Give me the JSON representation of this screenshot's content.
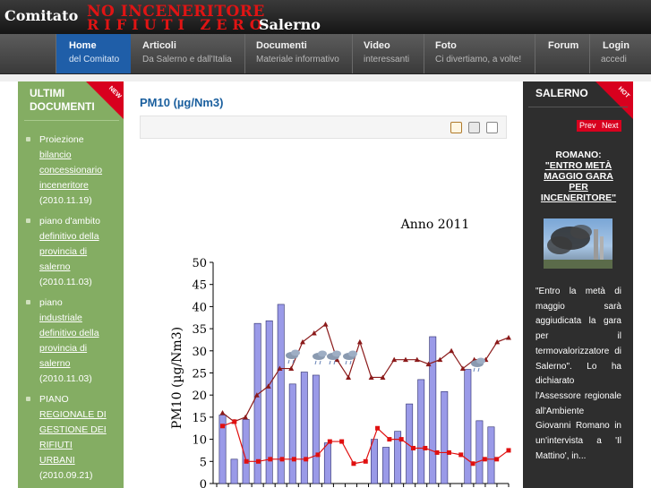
{
  "header": {
    "logo_left": "Comitato",
    "logo_red_line1": "NO INCENERITORE",
    "logo_red_line2": "RIFIUTI ZERO",
    "logo_right": "Salerno"
  },
  "nav": [
    {
      "title": "Home",
      "subtitle": "del Comitato",
      "active": true
    },
    {
      "title": "Articoli",
      "subtitle": "Da Salerno e dall'Italia"
    },
    {
      "title": "Documenti",
      "subtitle": "Materiale informativo"
    },
    {
      "title": "Video",
      "subtitle": "interessanti"
    },
    {
      "title": "Foto",
      "subtitle": "Ci divertiamo, a volte!"
    },
    {
      "title": "Forum",
      "subtitle": ""
    },
    {
      "title": "Login",
      "subtitle": "accedi"
    }
  ],
  "left_sidebar": {
    "title_line1": "ULTIMI",
    "title_line2": "DOCUMENTI",
    "badge": "NEW",
    "items": [
      {
        "prefix": "Proiezione",
        "link": [
          "bilancio",
          "concessionario",
          "inceneritore"
        ],
        "date": "(2010.11.19)"
      },
      {
        "prefix": "piano d'ambito",
        "link": [
          "definitivo della",
          "provincia di",
          "salerno"
        ],
        "date": "(2010.11.03)"
      },
      {
        "prefix": "piano",
        "link": [
          "industriale",
          "definitivo della",
          "provincia di",
          "salerno"
        ],
        "date": "(2010.11.03)"
      },
      {
        "prefix": "PIANO",
        "link": [
          "REGIONALE DI",
          "GESTIONE DEI",
          "RIFIUTI",
          "URBANI"
        ],
        "date": "(2010.09.21)"
      }
    ]
  },
  "main": {
    "title": "PM10 (µg/Nm3)",
    "tools": [
      "edit-icon",
      "print-icon",
      "email-icon"
    ]
  },
  "right_sidebar": {
    "title": "SALERNO",
    "badge": "HOT",
    "prev_label": "Prev",
    "next_label": "Next",
    "news_title_line1": "ROMANO:",
    "news_title_link": "\"ENTRO METÀ MAGGIO GARA PER INCENERITORE\"",
    "news_text": "\"Entro la metà di maggio sarà aggiudicata la gara per il termovalorizzatore di Salerno\". Lo ha dichiarato l'Assessore regionale all'Ambiente Giovanni Romano in un'intervista a 'Il Mattino', in..."
  },
  "chart_data": {
    "type": "bar",
    "title": "Anno 2011",
    "ylabel": "PM10 (µg/Nm3)",
    "ylim": [
      0,
      50
    ],
    "yticks": [
      0,
      5,
      10,
      15,
      20,
      25,
      30,
      35,
      40,
      45,
      50
    ],
    "grid": false,
    "weather_icons": "rain clouds shown above several bars",
    "series": [
      {
        "name": "",
        "kind": "bar",
        "color": "#9a9ae8",
        "values": [
          15.5,
          5.5,
          14.5,
          36.2,
          36.8,
          40.5,
          22.5,
          25.2,
          24.5,
          9.2,
          0,
          0,
          0,
          10,
          8.2,
          11.8,
          18,
          23.5,
          33.2,
          20.8,
          0,
          25.8,
          14.2,
          12.8,
          0
        ]
      },
      {
        "name": "",
        "kind": "line",
        "color": "#8b1a1a",
        "values": [
          16,
          14,
          15,
          20,
          22,
          26,
          26,
          32,
          34,
          36,
          28,
          24,
          32,
          24,
          24,
          28,
          28,
          28,
          27,
          28,
          30,
          26,
          28,
          28,
          32,
          33
        ]
      },
      {
        "name": "",
        "kind": "line",
        "color": "#e01010",
        "values": [
          13,
          14,
          5,
          5,
          5.5,
          5.5,
          5.5,
          5.5,
          6.5,
          9.5,
          9.5,
          4.5,
          5,
          12.5,
          10,
          10,
          8,
          8,
          7,
          7,
          6.5,
          4.5,
          5.5,
          5.5,
          7.5
        ]
      }
    ]
  }
}
